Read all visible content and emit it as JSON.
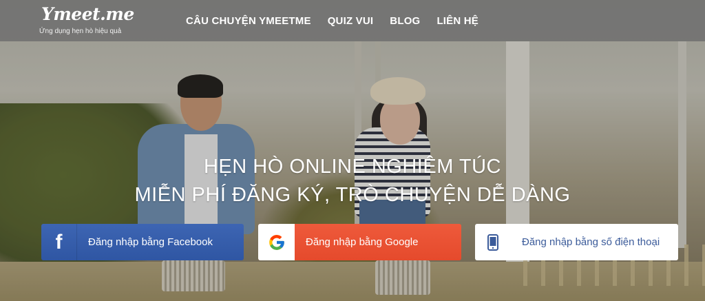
{
  "brand": {
    "logo_text": "Ymeet.me",
    "tagline": "Ứng dụng hẹn hò hiệu quả"
  },
  "nav": {
    "items": [
      {
        "label": "CÂU CHUYỆN YMEETME"
      },
      {
        "label": "QUIZ VUI"
      },
      {
        "label": "BLOG"
      },
      {
        "label": "LIÊN HỆ"
      }
    ]
  },
  "hero": {
    "line1": "HẸN HÒ ONLINE NGHIÊM TÚC",
    "line2": "MIỄN PHÍ ĐĂNG KÝ, TRÒ CHUYỆN DỄ DÀNG"
  },
  "login": {
    "facebook": {
      "label": "Đăng nhập bằng Facebook",
      "icon": "facebook-icon",
      "color": "#3b5998"
    },
    "google": {
      "label": "Đăng nhập bằng Google",
      "icon": "google-icon",
      "color": "#e9532f"
    },
    "phone": {
      "label": "Đăng nhập bằng số điện thoại",
      "icon": "phone-icon",
      "color": "#3b5b9a"
    }
  }
}
